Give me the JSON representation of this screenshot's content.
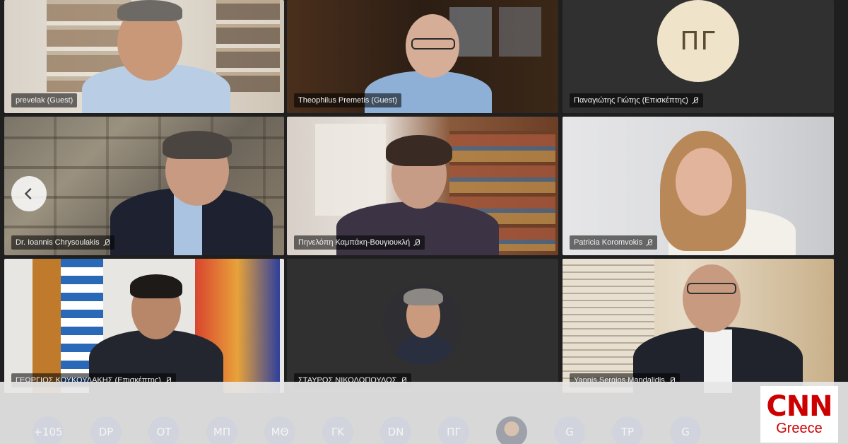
{
  "tiles": [
    {
      "name": "prevelak (Guest)",
      "muted": false
    },
    {
      "name": "Theophilus Premetis (Guest)",
      "muted": false
    },
    {
      "name": "Παναγιώτης Γιώτης (Επισκέπτης)",
      "muted": true,
      "initials": "ΠΓ"
    },
    {
      "name": "Dr. Ioannis Chrysoulakis",
      "muted": true
    },
    {
      "name": "Πηνελόπη Καμπάκη-Βουγιουκλή",
      "muted": true
    },
    {
      "name": "Patricia Koromvokis",
      "muted": true
    },
    {
      "name": "ΓΕΩΡΓΙΟΣ ΚΟΥΚΟΥΛΑΚΗΣ (Επισκέπτης)",
      "muted": true
    },
    {
      "name": "ΣΤΑΥΡΟΣ ΝΙΚΟΛΟΠΟΥΛΟΣ",
      "muted": true
    },
    {
      "name": "Yannis Sergios Mandalidis",
      "muted": true
    }
  ],
  "roster": [
    "+105",
    "DP",
    "ΟΤ",
    "ΜΠ",
    "ΜΘ",
    "ΓΚ",
    "DN",
    "ΠΓ",
    "",
    "G",
    "TP",
    "G"
  ],
  "logo": {
    "brand": "CNN",
    "region": "Greece"
  },
  "colors": {
    "brand_red": "#cc0000",
    "avatar_bg": "#efe3c9"
  }
}
